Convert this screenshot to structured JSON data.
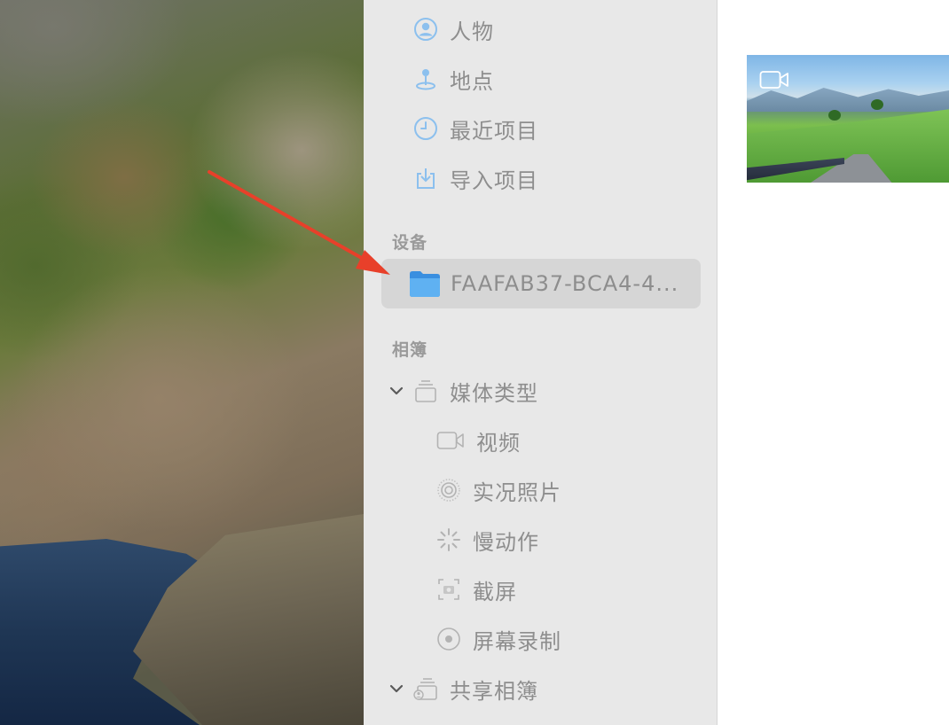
{
  "sidebar": {
    "library_items": [
      {
        "label": "人物",
        "icon": "person-circle-icon"
      },
      {
        "label": "地点",
        "icon": "map-pin-icon"
      },
      {
        "label": "最近项目",
        "icon": "clock-icon"
      },
      {
        "label": "导入项目",
        "icon": "import-tray-icon"
      }
    ],
    "devices_heading": "设备",
    "device": {
      "label": "FAAFAB37-BCA4-4...",
      "icon": "folder-icon"
    },
    "albums_heading": "相簿",
    "media_types": {
      "label": "媒体类型",
      "icon": "stack-icon"
    },
    "media_items": [
      {
        "label": "视频",
        "icon": "video-camera-icon"
      },
      {
        "label": "实况照片",
        "icon": "live-photo-icon"
      },
      {
        "label": "慢动作",
        "icon": "slow-motion-icon"
      },
      {
        "label": "截屏",
        "icon": "screenshot-icon"
      },
      {
        "label": "屏幕录制",
        "icon": "screen-record-icon"
      }
    ],
    "shared_albums": {
      "label": "共享相簿",
      "icon": "shared-stack-icon"
    }
  },
  "colors": {
    "sidebar_bg": "#e8e8e8",
    "selected_bg": "#d6d6d6",
    "accent_blue": "#4aa3e8",
    "label_gray": "#8e8e8e",
    "arrow_red": "#e8402a"
  }
}
